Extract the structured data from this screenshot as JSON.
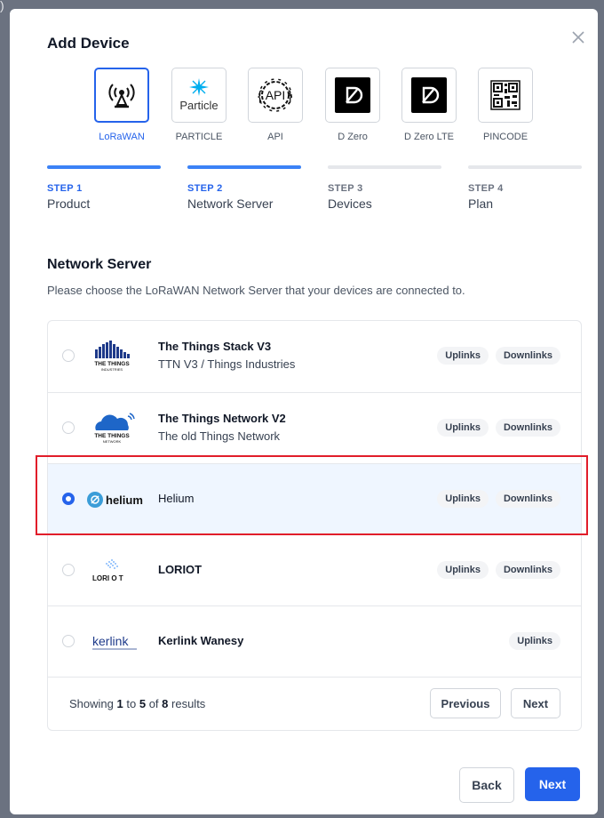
{
  "background_marker": ")",
  "modal": {
    "title": "Add Device",
    "close_icon": "close-icon"
  },
  "device_types": [
    {
      "label": "LoRaWAN",
      "icon": "antenna-icon",
      "selected": true
    },
    {
      "label": "PARTICLE",
      "icon": "particle-logo",
      "logo_text": "Particle",
      "selected": false
    },
    {
      "label": "API",
      "icon": "api-gear-icon",
      "logo_text": "API",
      "selected": false
    },
    {
      "label": "D Zero",
      "icon": "dzero-logo",
      "selected": false
    },
    {
      "label": "D Zero LTE",
      "icon": "dzero-logo",
      "selected": false
    },
    {
      "label": "PINCODE",
      "icon": "qr-code-icon",
      "selected": false
    }
  ],
  "steps": [
    {
      "number": "STEP 1",
      "name": "Product",
      "active": true
    },
    {
      "number": "STEP 2",
      "name": "Network Server",
      "active": true
    },
    {
      "number": "STEP 3",
      "name": "Devices",
      "active": false
    },
    {
      "number": "STEP 4",
      "name": "Plan",
      "active": false
    }
  ],
  "section": {
    "title": "Network Server",
    "description": "Please choose the LoRaWAN Network Server that your devices are connected to."
  },
  "servers": [
    {
      "title": "The Things Stack V3",
      "subtitle": "TTN V3 / Things Industries",
      "logo": "things-industries-logo",
      "logo_text": "THE THINGS",
      "logo_subtext": "INDUSTRIES",
      "badges": [
        "Uplinks",
        "Downlinks"
      ],
      "selected": false
    },
    {
      "title": "The Things Network V2",
      "subtitle": "The old Things Network",
      "logo": "things-network-logo",
      "logo_text": "THE THINGS",
      "logo_subtext": "NETWORK",
      "badges": [
        "Uplinks",
        "Downlinks"
      ],
      "selected": false
    },
    {
      "title": "Helium",
      "subtitle": "",
      "logo": "helium-logo",
      "logo_text": "helium",
      "badges": [
        "Uplinks",
        "Downlinks"
      ],
      "selected": true
    },
    {
      "title": "LORIOT",
      "subtitle": "",
      "logo": "loriot-logo",
      "logo_text": "LORI O T",
      "badges": [
        "Uplinks",
        "Downlinks"
      ],
      "selected": false
    },
    {
      "title": "Kerlink Wanesy",
      "subtitle": "",
      "logo": "kerlink-logo",
      "logo_text": "kerlink",
      "badges": [
        "Uplinks"
      ],
      "selected": false
    }
  ],
  "pagination": {
    "prefix": "Showing",
    "from": "1",
    "to_word": "to",
    "to": "5",
    "of_word": "of",
    "total": "8",
    "suffix": "results",
    "previous_label": "Previous",
    "next_label": "Next"
  },
  "footer": {
    "back_label": "Back",
    "next_label": "Next"
  },
  "colors": {
    "primary": "#2563eb",
    "highlight_border": "#e11d2a",
    "selected_row_bg": "#eff6ff"
  }
}
